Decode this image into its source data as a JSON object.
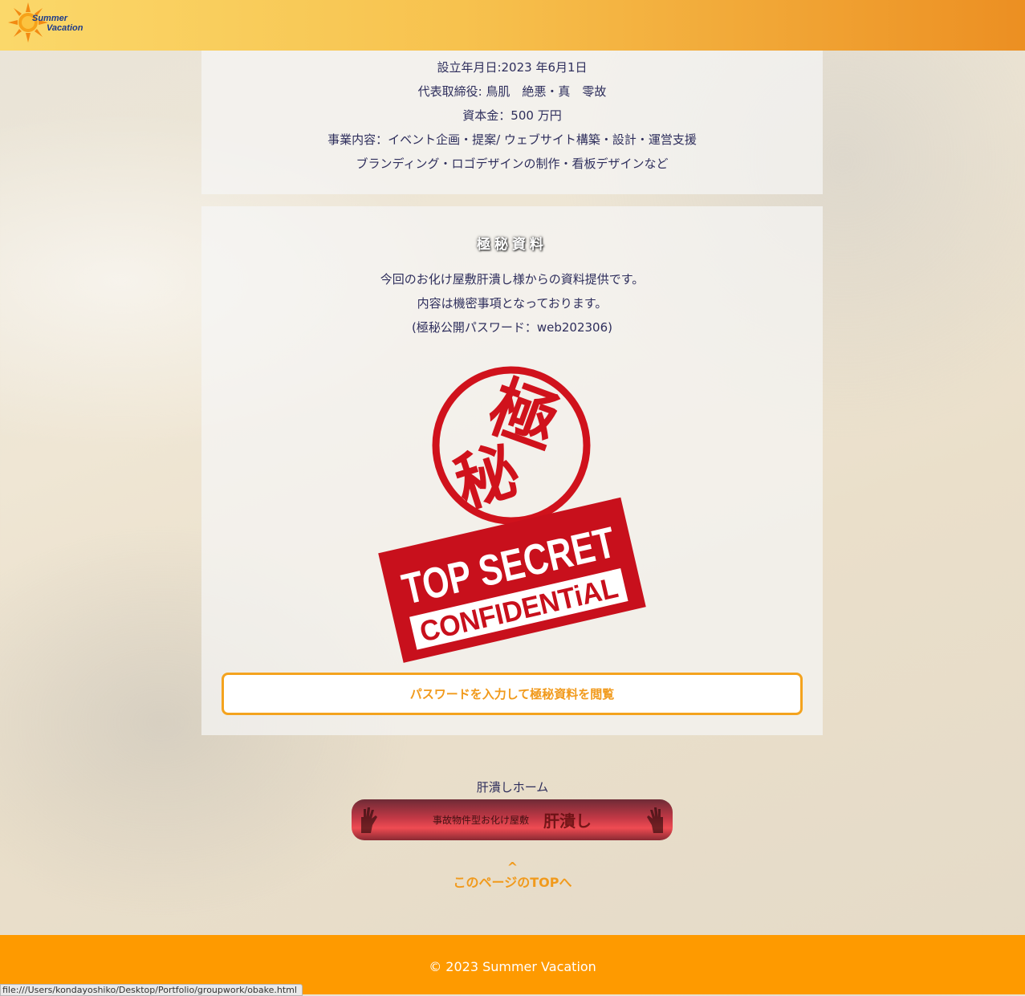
{
  "header": {
    "logo_line1": "Summer",
    "logo_line2": "Vacation"
  },
  "company": {
    "lines": [
      "設立年月日:2023 年6月1日",
      "代表取締役: 鳥肌　絶悪・真　零故",
      "資本金：500 万円",
      "事業内容：イベント企画・提案/ ウェブサイト構築・設計・運営支援",
      "ブランディング・ロゴデザインの制作・看板デザインなど"
    ]
  },
  "secret": {
    "title": "極秘資料",
    "desc": [
      "今回のお化け屋敷肝潰し様からの資料提供です。",
      "内容は機密事項となっております。",
      "(極秘公開パスワード：web202306)"
    ],
    "stamp_kanji_1": "極",
    "stamp_kanji_2": "秘",
    "stamp_top": "TOP SECRET",
    "stamp_bottom": "CONFIDENTiAL",
    "button_label": "パスワードを入力して極秘資料を閲覧"
  },
  "home_link": {
    "label": "肝潰しホーム",
    "banner_subtitle": "事故物件型お化け屋敷",
    "banner_title": "肝潰し"
  },
  "to_top": {
    "caret": "^",
    "label": "このページのTOPへ"
  },
  "footer": {
    "copyright": "© 2023 Summer Vacation"
  },
  "status_bar": {
    "url": "file:///Users/kondayoshiko/Desktop/Portfolio/groupwork/obake.html"
  },
  "colors": {
    "accent": "#f19a1c",
    "footer_bg": "#fe9a00",
    "stamp_red": "#c8101c"
  }
}
